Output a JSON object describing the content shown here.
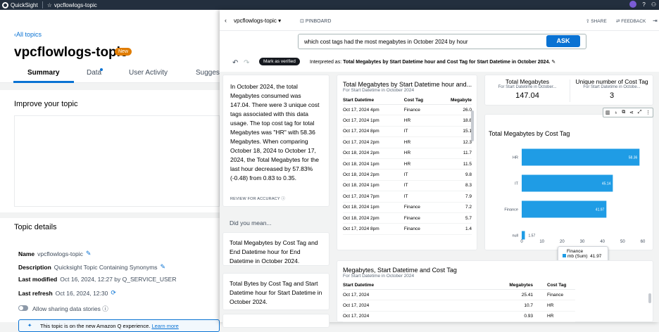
{
  "topbar": {
    "app": "QuickSight",
    "topic": "vpcflowlogs-topic"
  },
  "left": {
    "back": "All topics",
    "title": "vpcflowlogs-topic",
    "badge": "New",
    "tabs": [
      "Summary",
      "Data",
      "User Activity",
      "Sugges"
    ],
    "improve": "Improve your topic",
    "details_heading": "Topic details",
    "details": [
      {
        "label": "Name",
        "value": "vpcflowlogs-topic"
      },
      {
        "label": "Description",
        "value": "Quicksight Topic Containing Synonyms"
      },
      {
        "label": "Last modified",
        "value": "Oct 16, 2024, 12:27 by Q_SERVICE_USER"
      },
      {
        "label": "Last refresh",
        "value": "Oct 16, 2024, 12:30"
      }
    ],
    "sharing": "Allow sharing data stories",
    "info": "This topic is on the new Amazon Q experience.",
    "learn": "Learn more"
  },
  "panel": {
    "topic": "vpcflowlogs-topic",
    "pinboard": "PINBOARD",
    "share": "SHARE",
    "feedback": "FEEDBACK",
    "question": "which cost tags had the most megabytes in October 2024 by hour",
    "ask": "ASK",
    "verified": "Mark as verified",
    "interp_prefix": "Interpreted as:",
    "interp": "Total Megabytes by Start Datetime hour and Cost Tag for Start Datetime in October 2024.",
    "summary": "In October 2024, the total Megabytes consumed was 147.04. There were 3 unique cost tags associated with this data usage. The top cost tag for total Megabytes was \"HR\" with 58.36 Megabytes. When comparing October 18, 2024 to October 17, 2024, the Total Megabytes for the last hour decreased by 57.83% (-0.48) from 0.83 to 0.35.",
    "review": "REVIEW FOR ACCURACY",
    "did_you_mean": "Did you mean...",
    "suggestions": [
      "Total Megabytes by Cost Tag and End Datetime hour for End Datetime in October 2024.",
      "Total Bytes by Cost Tag and Start Datetime hour for Start Datetime in October 2024."
    ],
    "table1": {
      "title": "Total Megabytes by Start Datetime hour and...",
      "subtitle": "For Start Datetime in October 2024",
      "headers": [
        "Start Datetime",
        "Cost Tag",
        "Megabyte"
      ],
      "rows": [
        [
          "Oct 17, 2024 4pm",
          "Finance",
          "26.0"
        ],
        [
          "Oct 17, 2024 1pm",
          "HR",
          "18.8"
        ],
        [
          "Oct 17, 2024 8pm",
          "IT",
          "15.1"
        ],
        [
          "Oct 17, 2024 2pm",
          "HR",
          "12.3"
        ],
        [
          "Oct 18, 2024 2pm",
          "HR",
          "11.7"
        ],
        [
          "Oct 18, 2024 1pm",
          "HR",
          "11.5"
        ],
        [
          "Oct 18, 2024 2pm",
          "IT",
          "9.8"
        ],
        [
          "Oct 18, 2024 1pm",
          "IT",
          "8.3"
        ],
        [
          "Oct 17, 2024 7pm",
          "IT",
          "7.9"
        ],
        [
          "Oct 18, 2024 1pm",
          "Finance",
          "7.2"
        ],
        [
          "Oct 18, 2024 2pm",
          "Finance",
          "5.7"
        ],
        [
          "Oct 17, 2024 8pm",
          "Finance",
          "1.4"
        ]
      ]
    },
    "kpis": [
      {
        "label": "Total Megabytes",
        "sub": "For Start Datetime in October...",
        "value": "147.04"
      },
      {
        "label": "Unique number of Cost Tag",
        "sub": "For Start Datetime in Octobe...",
        "value": "3"
      }
    ],
    "tooltip": {
      "title": "Finance",
      "series": "mb (Sum)",
      "value": "41.97"
    },
    "table2": {
      "title": "Megabytes, Start Datetime and Cost Tag",
      "subtitle": "For Start Datetime in October 2024",
      "headers": [
        "Start Datetime",
        "Megabytes",
        "Cost Tag"
      ],
      "rows": [
        [
          "Oct 17, 2024",
          "25.41",
          "Finance"
        ],
        [
          "Oct 17, 2024",
          "10.7",
          "HR"
        ],
        [
          "Oct 17, 2024",
          "0.93",
          "HR"
        ]
      ]
    }
  },
  "chart_data": {
    "type": "bar",
    "orientation": "horizontal",
    "title": "Total Megabytes by Cost Tag",
    "categories": [
      "HR",
      "IT",
      "Finance",
      "null"
    ],
    "values": [
      58.36,
      45.14,
      41.97,
      1.57
    ],
    "xticks": [
      0,
      10,
      20,
      30,
      40,
      50,
      60
    ],
    "xlim": [
      0,
      60
    ],
    "color": "#1f9ce5"
  }
}
